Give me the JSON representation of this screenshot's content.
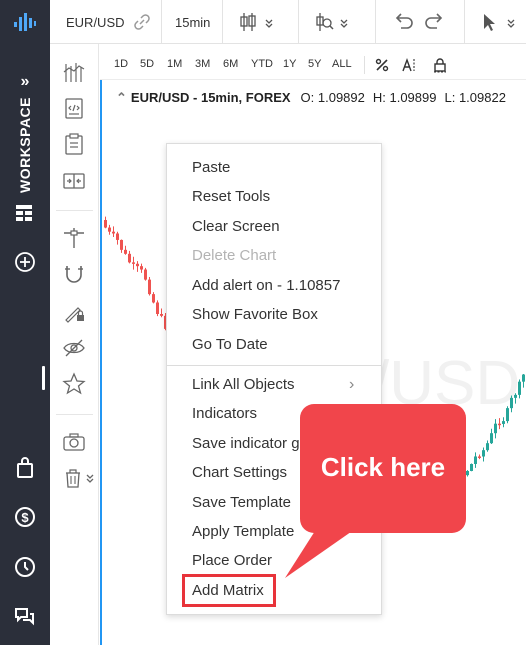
{
  "toolbar": {
    "symbol": "EUR/USD",
    "timeframe": "15min"
  },
  "workspace": {
    "label": "WORKSPACE"
  },
  "periods": [
    "1D",
    "5D",
    "1M",
    "3M",
    "6M",
    "YTD",
    "1Y",
    "5Y",
    "ALL"
  ],
  "legend": {
    "title": "EUR/USD - 15min, FOREX",
    "open": "O: 1.09892",
    "high": "H: 1.09899",
    "low": "L: 1.09822"
  },
  "chart_watermark": "/USD",
  "context_menu": {
    "items": [
      {
        "label": "Paste",
        "enabled": true
      },
      {
        "label": "Reset Tools",
        "enabled": true
      },
      {
        "label": "Clear Screen",
        "enabled": true
      },
      {
        "label": "Delete Chart",
        "enabled": false
      },
      {
        "label": "Add alert on - 1.10857",
        "enabled": true
      },
      {
        "label": "Show Favorite Box",
        "enabled": true
      },
      {
        "label": "Go To Date",
        "enabled": true
      },
      {
        "label": "Link All Objects",
        "enabled": true,
        "submenu": true
      },
      {
        "label": "Indicators",
        "enabled": true
      },
      {
        "label": "Save indicator g",
        "enabled": true
      },
      {
        "label": "Chart Settings",
        "enabled": true
      },
      {
        "label": "Save Template",
        "enabled": true
      },
      {
        "label": "Apply Template",
        "enabled": true
      },
      {
        "label": "Place Order",
        "enabled": true
      },
      {
        "label": "Add Matrix",
        "enabled": true,
        "highlighted": true
      }
    ]
  },
  "callout": {
    "text": "Click here"
  },
  "colors": {
    "rail": "#2b2f3a",
    "accent": "#2196f3",
    "callout": "#f1454b",
    "highlight_border": "#e8333a",
    "candle_up": "#26a69a",
    "candle_down": "#ef5350"
  }
}
